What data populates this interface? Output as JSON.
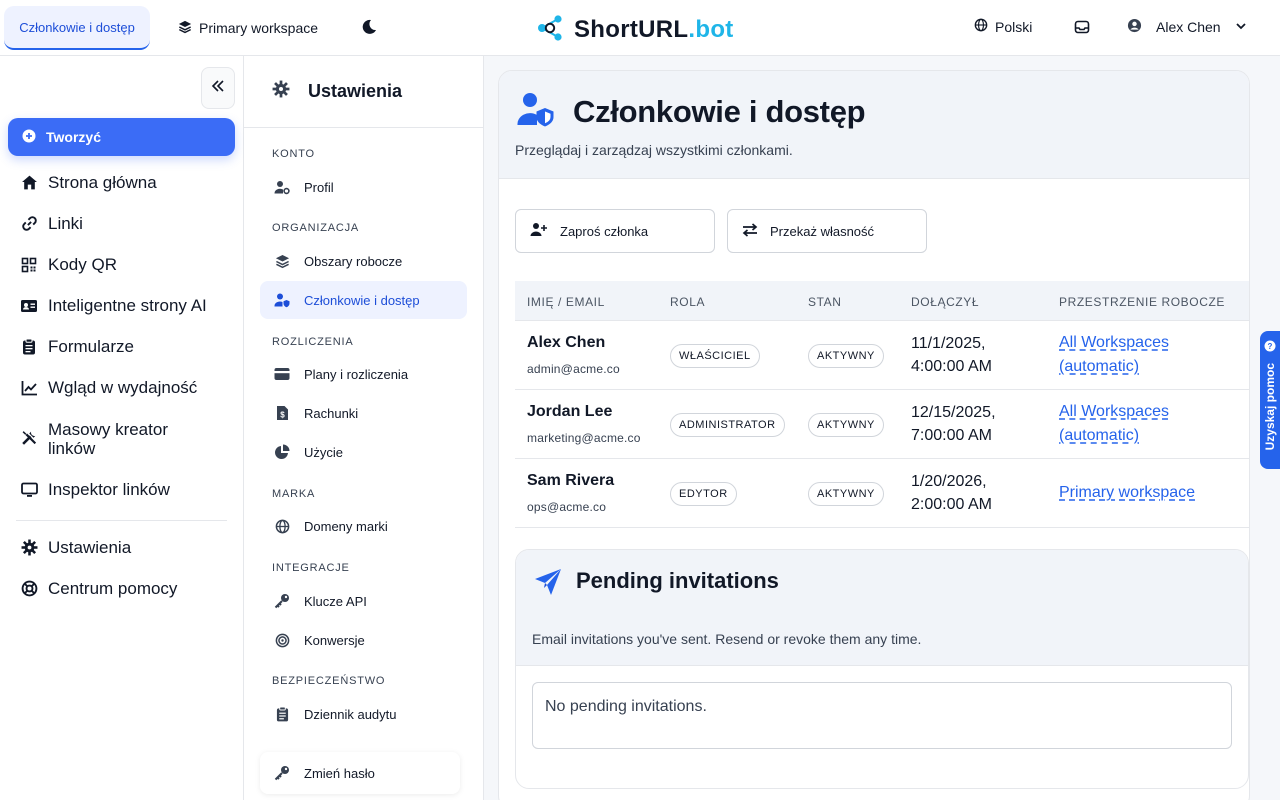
{
  "topbar": {
    "active_tab": "Członkowie i dostęp",
    "workspace": "Primary workspace",
    "logo_main": "ShortURL",
    "logo_suffix": ".bot",
    "language": "Polski",
    "user_name": "Alex Chen"
  },
  "leftnav": {
    "create_label": "Tworzyć",
    "items": [
      {
        "label": "Strona główna",
        "icon": "home-icon"
      },
      {
        "label": "Linki",
        "icon": "link-icon"
      },
      {
        "label": "Kody QR",
        "icon": "qr-code-icon"
      },
      {
        "label": "Inteligentne strony AI",
        "icon": "id-card-icon"
      },
      {
        "label": "Formularze",
        "icon": "clipboard-icon"
      },
      {
        "label": "Wgląd w wydajność",
        "icon": "chart-line-icon"
      },
      {
        "label": "Masowy kreator linków",
        "icon": "tools-icon"
      },
      {
        "label": "Inspektor linków",
        "icon": "monitor-icon"
      },
      {
        "label": "Ustawienia",
        "icon": "gear-icon"
      },
      {
        "label": "Centrum pomocy",
        "icon": "life-ring-icon"
      }
    ]
  },
  "settings": {
    "title": "Ustawienia",
    "sections": {
      "konto": "KONTO",
      "organizacja": "ORGANIZACJA",
      "rozliczenia": "ROZLICZENIA",
      "marka": "MARKA",
      "integracje": "INTEGRACJE",
      "bezpieczenstwo": "BEZPIECZEŃSTWO"
    },
    "items": {
      "profil": "Profil",
      "obszary": "Obszary robocze",
      "czlonkowie": "Członkowie i dostęp",
      "plany": "Plany i rozliczenia",
      "rachunki": "Rachunki",
      "uzycie": "Użycie",
      "domeny": "Domeny marki",
      "klucze": "Klucze API",
      "konwersje": "Konwersje",
      "dziennik": "Dziennik audytu",
      "zmien_haslo": "Zmień hasło"
    }
  },
  "main": {
    "title": "Członkowie i dostęp",
    "subtitle": "Przeglądaj i zarządzaj wszystkimi członkami.",
    "invite_button": "Zaproś członka",
    "transfer_button": "Przekaż własność",
    "columns": [
      "IMIĘ / EMAIL",
      "ROLA",
      "STAN",
      "DOŁĄCZYŁ",
      "PRZESTRZENIE ROBOCZE"
    ],
    "rows": [
      {
        "name": "Alex Chen",
        "email": "admin@acme.co",
        "role": "WŁAŚCICIEL",
        "status": "AKTYWNY",
        "joined": "11/1/2025, 4:00:00 AM",
        "workspaces": "All Workspaces (automatic)"
      },
      {
        "name": "Jordan Lee",
        "email": "marketing@acme.co",
        "role": "ADMINISTRATOR",
        "status": "AKTYWNY",
        "joined": "12/15/2025, 7:00:00 AM",
        "workspaces": "All Workspaces (automatic)"
      },
      {
        "name": "Sam Rivera",
        "email": "ops@acme.co",
        "role": "EDYTOR",
        "status": "AKTYWNY",
        "joined": "1/20/2026, 2:00:00 AM",
        "workspaces": "Primary workspace"
      }
    ],
    "pending": {
      "title": "Pending invitations",
      "subtitle": "Email invitations you've sent. Resend or revoke them any time.",
      "empty": "No pending invitations."
    }
  },
  "help_tab": "Uzyskaj pomoc",
  "colors": {
    "accent": "#3b6cf6",
    "link": "#2563eb",
    "logo_accent": "#1fb5e8"
  }
}
